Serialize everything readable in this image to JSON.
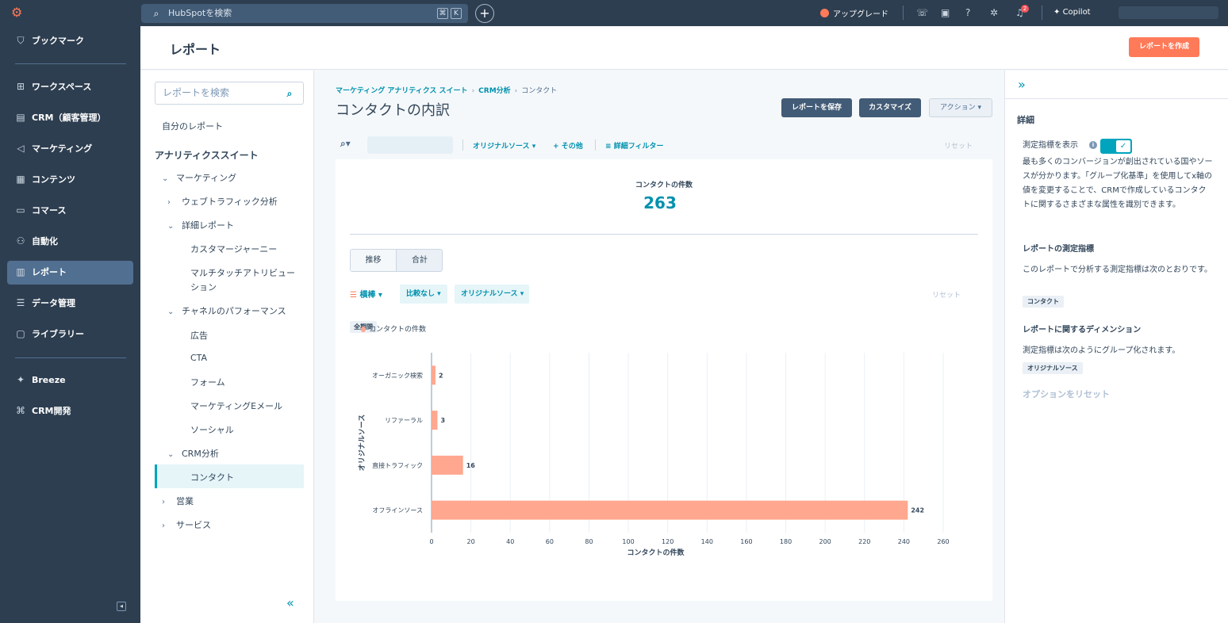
{
  "topbar": {
    "search_placeholder": "HubSpotを検索",
    "kbd1": "⌘",
    "kbd2": "K",
    "upgrade": "アップグレード",
    "notifications": "2",
    "copilot": "Copilot"
  },
  "nav": {
    "items": [
      {
        "label": "ブックマーク",
        "icon": "bookmark-icon"
      },
      {
        "label": "ワークスペース",
        "icon": "workspace-icon"
      },
      {
        "label": "CRM（顧客管理）",
        "icon": "crm-icon"
      },
      {
        "label": "マーケティング",
        "icon": "megaphone-icon"
      },
      {
        "label": "コンテンツ",
        "icon": "content-icon"
      },
      {
        "label": "コマース",
        "icon": "commerce-icon"
      },
      {
        "label": "自動化",
        "icon": "automation-icon"
      },
      {
        "label": "レポート",
        "icon": "bar-chart-icon"
      },
      {
        "label": "データ管理",
        "icon": "database-icon"
      },
      {
        "label": "ライブラリー",
        "icon": "folder-icon"
      },
      {
        "label": "Breeze",
        "icon": "sparkle-icon"
      },
      {
        "label": "CRM開発",
        "icon": "code-icon"
      }
    ]
  },
  "header": {
    "title": "レポート",
    "create_button": "レポートを作成"
  },
  "tree": {
    "search_placeholder": "レポートを検索",
    "my_reports": "自分のレポート",
    "suite": "アナリティクススイート",
    "items": [
      "マーケティング",
      "ウェブトラフィック分析",
      "詳細レポート",
      "カスタマージャーニー",
      "マルチタッチアトリビュー",
      "ション",
      "チャネルのパフォーマンス",
      "広告",
      "CTA",
      "フォーム",
      "マーケティングEメール",
      "ソーシャル",
      "CRM分析",
      "コンタクト",
      "営業",
      "サービス"
    ]
  },
  "main": {
    "breadcrumb": [
      "マーケティング アナリティクス スイート",
      "CRM分析",
      "コンタクト"
    ],
    "title": "コンタクトの内訳",
    "save_button": "レポートを保存",
    "customize_button": "カスタマイズ",
    "action_button": "アクション",
    "filters": {
      "source": "オリジナルソース",
      "more": "その他",
      "advanced": "詳細フィルター",
      "reset": "リセット"
    },
    "kpi_label": "コンタクトの件数",
    "kpi_value": "263",
    "tab_trend": "推移",
    "tab_total": "合計",
    "chart_type": "横棒",
    "compare": "比較なし",
    "group_by": "オリジナルソース",
    "reset": "リセット",
    "period": "全期間"
  },
  "right": {
    "details": "詳細",
    "show_metric": "測定指標を表示",
    "description": "最も多くのコンバージョンが創出されている国やソースが分かります。「グループ化基準」を使用してx軸の値を変更することで、CRMで作成しているコンタクトに関するさまざまな属性を識別できます。",
    "metrics_title": "レポートの測定指標",
    "metrics_text": "このレポートで分析する測定指標は次のとおりです。",
    "metric_tag": "コンタクト",
    "dims_title": "レポートに関するディメンション",
    "dims_text": "測定指標は次のようにグループ化されます。",
    "dim_tag": "オリジナルソース",
    "reset_options": "オプションをリセット"
  },
  "colors": {
    "bar": "#ffa78f",
    "accent": "#0091ae",
    "primary": "#ff7a59"
  },
  "chart_data": {
    "type": "bar",
    "orientation": "horizontal",
    "categories": [
      "オーガニック検索",
      "リファーラル",
      "直接トラフィック",
      "オフラインソース"
    ],
    "series": [
      {
        "name": "コンタクトの件数",
        "values": [
          2,
          3,
          16,
          242
        ]
      }
    ],
    "xlabel": "コンタクトの件数",
    "ylabel": "オリジナルソース",
    "xlim": [
      0,
      260
    ],
    "xticks": [
      0,
      20,
      40,
      60,
      80,
      100,
      120,
      140,
      160,
      180,
      200,
      220,
      240,
      260
    ],
    "legend": "top-left",
    "grid": true
  }
}
